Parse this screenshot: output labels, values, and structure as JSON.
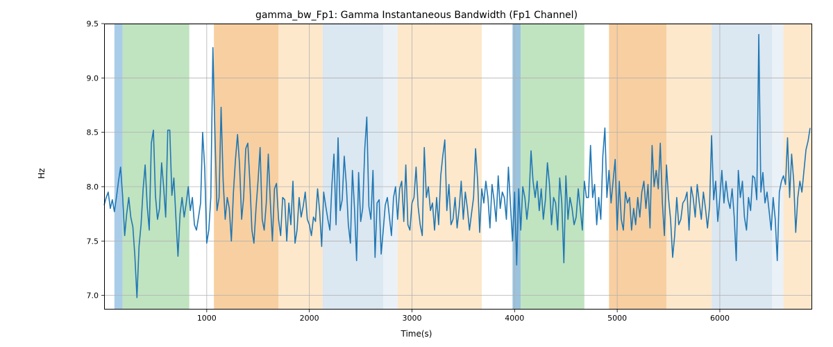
{
  "chart_data": {
    "type": "line",
    "title": "gamma_bw_Fp1: Gamma Instantaneous Bandwidth (Fp1 Channel)",
    "xlabel": "Time(s)",
    "ylabel": "Hz",
    "xlim": [
      0,
      6900
    ],
    "ylim": [
      6.87,
      9.5
    ],
    "xticks": [
      1000,
      2000,
      3000,
      4000,
      5000,
      6000
    ],
    "yticks": [
      7.0,
      7.5,
      8.0,
      8.5,
      9.0,
      9.5
    ],
    "bands": [
      {
        "x0": 100,
        "x1": 180,
        "color": "#a9cde8"
      },
      {
        "x0": 180,
        "x1": 830,
        "color": "#c0e3c0"
      },
      {
        "x0": 1070,
        "x1": 1700,
        "color": "#f8cfa0"
      },
      {
        "x0": 1700,
        "x1": 2130,
        "color": "#fde8cc"
      },
      {
        "x0": 2130,
        "x1": 2720,
        "color": "#dbe7f1"
      },
      {
        "x0": 2720,
        "x1": 2860,
        "color": "#eaf1f7"
      },
      {
        "x0": 2860,
        "x1": 3680,
        "color": "#fde8cc"
      },
      {
        "x0": 3980,
        "x1": 4060,
        "color": "#9cc3dd"
      },
      {
        "x0": 4060,
        "x1": 4680,
        "color": "#c0e3c0"
      },
      {
        "x0": 4920,
        "x1": 5480,
        "color": "#f8cfa0"
      },
      {
        "x0": 5480,
        "x1": 5920,
        "color": "#fde8cc"
      },
      {
        "x0": 5920,
        "x1": 6510,
        "color": "#dbe7f1"
      },
      {
        "x0": 6510,
        "x1": 6620,
        "color": "#eaf1f7"
      },
      {
        "x0": 6620,
        "x1": 6900,
        "color": "#fde8cc"
      }
    ],
    "series": [
      {
        "name": "gamma_bw_Fp1",
        "x_step": 20,
        "x_start": 0,
        "values": [
          7.83,
          7.9,
          7.95,
          7.8,
          7.88,
          7.77,
          7.9,
          8.05,
          8.18,
          7.92,
          7.55,
          7.75,
          7.9,
          7.72,
          7.63,
          7.36,
          6.98,
          7.45,
          7.65,
          7.98,
          8.2,
          7.82,
          7.6,
          8.4,
          8.52,
          7.92,
          7.7,
          7.8,
          8.22,
          8.0,
          7.72,
          8.52,
          8.52,
          7.92,
          8.08,
          7.7,
          7.36,
          7.75,
          7.9,
          7.72,
          7.85,
          8.0,
          7.78,
          7.9,
          7.65,
          7.6,
          7.72,
          7.85,
          8.5,
          8.17,
          7.48,
          7.6,
          7.9,
          9.28,
          8.47,
          7.78,
          7.9,
          8.73,
          8.05,
          7.7,
          7.9,
          7.8,
          7.5,
          7.95,
          8.25,
          8.48,
          8.2,
          7.7,
          7.9,
          8.35,
          8.4,
          8.05,
          7.6,
          7.48,
          7.8,
          8.05,
          8.36,
          7.7,
          7.6,
          7.85,
          8.3,
          7.85,
          7.5,
          7.98,
          8.03,
          7.7,
          7.55,
          7.9,
          7.88,
          7.5,
          7.85,
          7.65,
          8.05,
          7.48,
          7.6,
          7.9,
          7.72,
          7.82,
          7.95,
          7.7,
          7.65,
          7.55,
          7.72,
          7.68,
          7.98,
          7.78,
          7.45,
          7.95,
          7.82,
          7.7,
          7.6,
          8.02,
          8.3,
          7.65,
          8.45,
          7.78,
          7.88,
          8.28,
          8.02,
          7.65,
          7.48,
          8.15,
          7.8,
          7.32,
          8.13,
          7.68,
          7.8,
          8.35,
          8.64,
          7.82,
          7.7,
          8.15,
          7.35,
          7.85,
          7.88,
          7.38,
          7.6,
          7.83,
          7.9,
          7.72,
          7.55,
          7.9,
          8.0,
          7.7,
          7.98,
          8.05,
          7.68,
          8.2,
          7.65,
          7.6,
          7.85,
          7.9,
          8.18,
          7.82,
          7.65,
          7.55,
          8.36,
          7.9,
          8.0,
          7.78,
          7.85,
          7.6,
          7.9,
          7.65,
          8.1,
          8.28,
          8.43,
          7.78,
          8.02,
          7.65,
          7.7,
          7.9,
          7.62,
          7.8,
          8.05,
          7.7,
          7.95,
          7.8,
          7.6,
          7.75,
          7.9,
          8.35,
          8.05,
          7.58,
          7.98,
          7.85,
          8.05,
          7.9,
          7.62,
          8.02,
          7.88,
          7.68,
          8.1,
          7.8,
          7.95,
          7.9,
          7.7,
          8.18,
          7.83,
          7.5,
          7.95,
          7.28,
          7.98,
          7.6,
          8.0,
          7.9,
          7.7,
          7.88,
          8.33,
          8.05,
          7.9,
          8.05,
          7.78,
          7.98,
          7.7,
          7.88,
          8.22,
          8.02,
          7.65,
          7.9,
          7.85,
          7.6,
          8.08,
          7.85,
          7.3,
          8.1,
          7.7,
          7.9,
          7.8,
          7.65,
          7.72,
          7.98,
          7.8,
          7.6,
          8.05,
          7.9,
          7.9,
          8.38,
          7.9,
          8.02,
          7.65,
          7.9,
          7.7,
          8.28,
          8.54,
          7.9,
          8.15,
          7.85,
          8.05,
          8.25,
          7.6,
          8.05,
          7.7,
          7.6,
          7.95,
          7.85,
          7.9,
          7.6,
          7.8,
          7.65,
          7.9,
          7.72,
          7.95,
          8.05,
          7.8,
          8.02,
          7.62,
          8.38,
          8.0,
          8.15,
          7.98,
          8.4,
          7.85,
          7.55,
          8.2,
          7.9,
          7.7,
          7.35,
          7.55,
          7.9,
          7.65,
          7.7,
          7.85,
          7.88,
          7.95,
          7.6,
          8.0,
          7.9,
          7.72,
          8.02,
          7.85,
          7.7,
          7.95,
          7.8,
          7.62,
          7.82,
          8.47,
          7.88,
          8.05,
          7.68,
          7.9,
          8.15,
          7.85,
          8.05,
          7.88,
          7.8,
          7.98,
          7.72,
          7.32,
          8.15,
          7.9,
          8.05,
          7.72,
          7.6,
          7.9,
          7.78,
          8.1,
          8.08,
          7.88,
          9.4,
          7.95,
          8.13,
          7.85,
          7.95,
          7.78,
          7.6,
          7.9,
          7.7,
          7.32,
          7.95,
          8.05,
          8.1,
          8.02,
          8.45,
          7.9,
          8.3,
          8.05,
          7.58,
          7.9,
          8.05,
          7.95,
          8.15,
          8.34,
          8.42,
          8.54
        ]
      }
    ]
  }
}
